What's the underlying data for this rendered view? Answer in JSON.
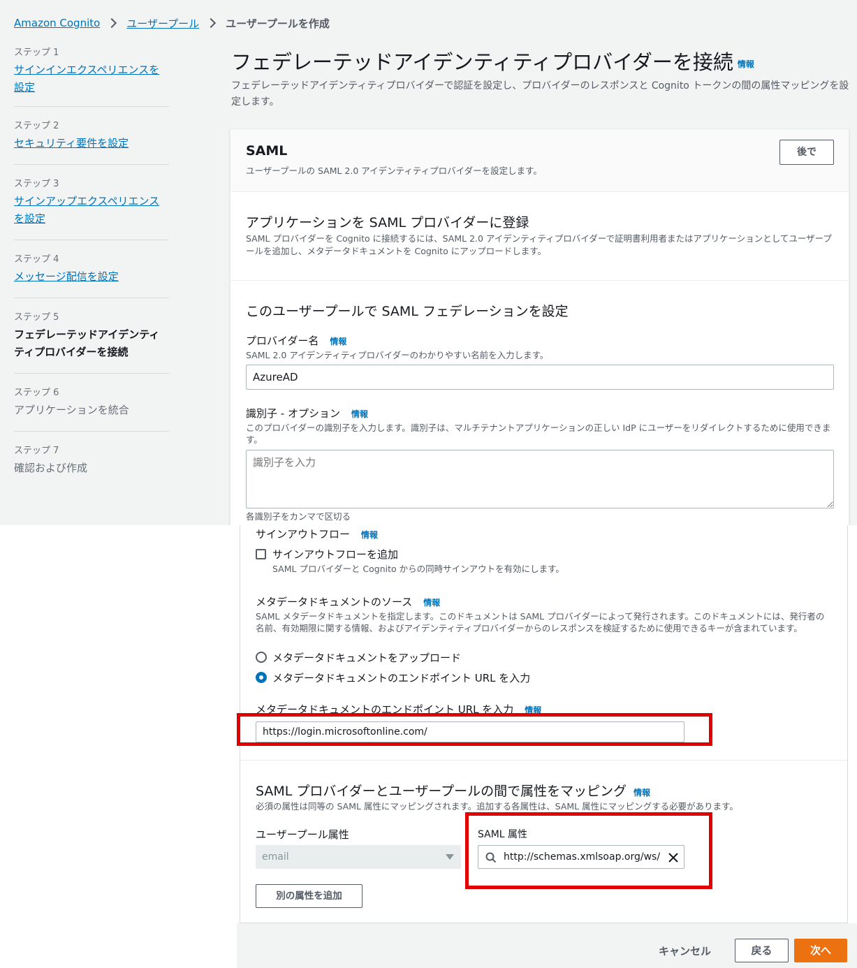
{
  "breadcrumb": {
    "items": [
      "Amazon Cognito",
      "ユーザープール"
    ],
    "current": "ユーザープールを作成"
  },
  "nav": {
    "steps": [
      {
        "label": "ステップ 1",
        "title": "サインインエクスペリエンスを設定"
      },
      {
        "label": "ステップ 2",
        "title": "セキュリティ要件を設定"
      },
      {
        "label": "ステップ 3",
        "title": "サインアップエクスペリエンスを設定"
      },
      {
        "label": "ステップ 4",
        "title": "メッセージ配信を設定"
      },
      {
        "label": "ステップ 5",
        "title": "フェデレーテッドアイデンティティプロバイダーを接続"
      },
      {
        "label": "ステップ 6",
        "title": "アプリケーションを統合"
      },
      {
        "label": "ステップ 7",
        "title": "確認および作成"
      }
    ]
  },
  "page": {
    "title": "フェデレーテッドアイデンティティプロバイダーを接続",
    "info": "情報",
    "description": "フェデレーテッドアイデンティティプロバイダーで認証を設定し、プロバイダーのレスポンスと Cognito トークンの間の属性マッピングを設定します。"
  },
  "saml": {
    "title": "SAML",
    "subtitle": "ユーザープールの SAML 2.0 アイデンティティプロバイダーを設定します。",
    "later_button": "後で",
    "register": {
      "title": "アプリケーションを SAML プロバイダーに登録",
      "description": "SAML プロバイダーを Cognito に接続するには、SAML 2.0 アイデンティティプロバイダーで証明書利用者またはアプリケーションとしてユーザープールを追加し、メタデータドキュメントを Cognito にアップロードします。"
    },
    "federation": {
      "title": "このユーザープールで SAML フェデレーションを設定",
      "provider_name": {
        "label": "プロバイダー名",
        "info": "情報",
        "description": "SAML 2.0 アイデンティティプロバイダーのわかりやすい名前を入力します。",
        "value": "AzureAD"
      },
      "identifier": {
        "label": "識別子 - オプション",
        "info": "情報",
        "description": "このプロバイダーの識別子を入力します。識別子は、マルチテナントアプリケーションの正しい IdP にユーザーをリダイレクトするために使用できます。",
        "placeholder": "識別子を入力",
        "hint": "各識別子をカンマで区切る"
      },
      "signout": {
        "label": "サインアウトフロー",
        "info": "情報",
        "checkbox_label": "サインアウトフローを追加",
        "checkbox_description": "SAML プロバイダーと Cognito からの同時サインアウトを有効にします。"
      },
      "metadata_source": {
        "label": "メタデータドキュメントのソース",
        "info": "情報",
        "description": "SAML メタデータドキュメントを指定します。このドキュメントは SAML プロバイダーによって発行されます。このドキュメントには、発行者の名前、有効期限に関する情報、およびアイデンティティプロバイダーからのレスポンスを検証するために使用できるキーが含まれています。",
        "options": [
          "メタデータドキュメントをアップロード",
          "メタデータドキュメントのエンドポイント URL を入力"
        ],
        "selected": 1
      },
      "metadata_url": {
        "label": "メタデータドキュメントのエンドポイント URL を入力",
        "info": "情報",
        "value": "https://login.microsoftonline.com/"
      }
    },
    "mapping": {
      "title": "SAML プロバイダーとユーザープールの間で属性をマッピング",
      "info": "情報",
      "description": "必須の属性は同等の SAML 属性にマッピングされます。追加する各属性は、SAML 属性にマッピングする必要があります。",
      "user_pool_attr_label": "ユーザープール属性",
      "user_pool_attr_value": "email",
      "saml_attr_label": "SAML 属性",
      "saml_attr_value": "http://schemas.xmlsoap.org/ws/",
      "add_button": "別の属性を追加"
    }
  },
  "footer": {
    "cancel": "キャンセル",
    "back": "戻る",
    "next": "次へ"
  },
  "colors": {
    "link": "#0073bb",
    "primary": "#ec7211",
    "highlight": "#e00000"
  }
}
